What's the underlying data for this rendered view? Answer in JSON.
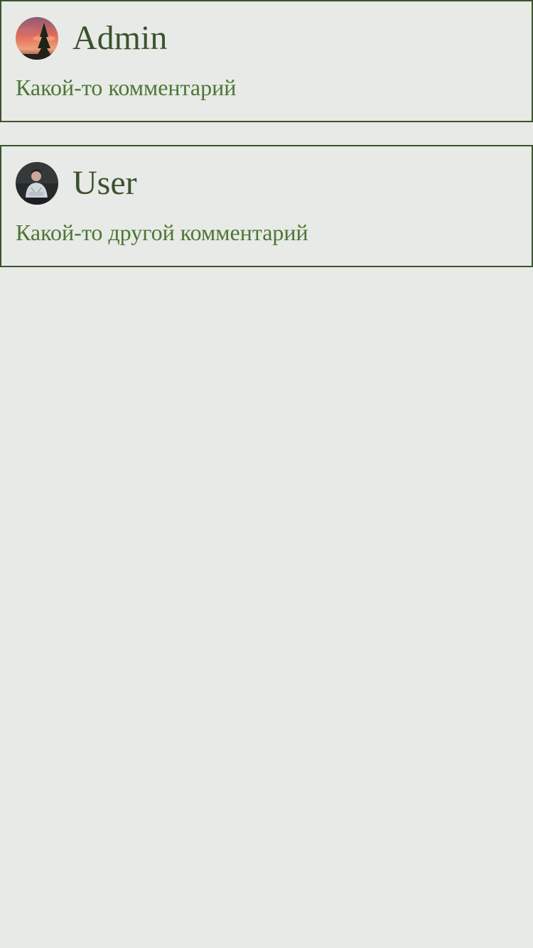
{
  "comments": [
    {
      "author": "Admin",
      "avatar_icon": "avatar-sunset-tree",
      "text": "Какой-то комментарий"
    },
    {
      "author": "User",
      "avatar_icon": "avatar-person-photo",
      "text": "Какой-то другой комментарий"
    }
  ],
  "colors": {
    "background": "#e7eae6",
    "border": "#3b532d",
    "author": "#3b532d",
    "comment_text": "#4e7535"
  }
}
